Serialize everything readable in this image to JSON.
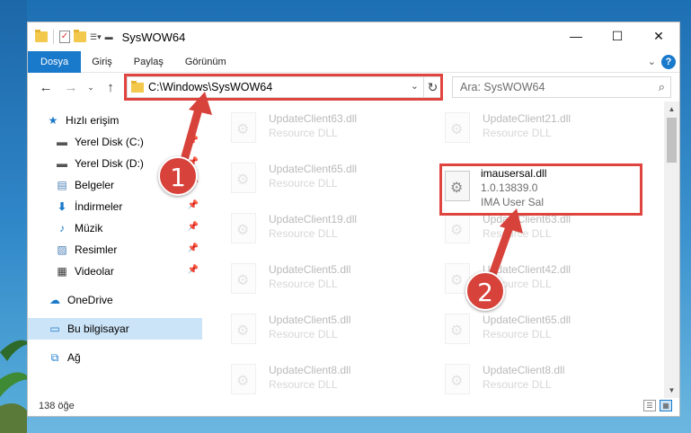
{
  "window": {
    "title": "SysWOW64",
    "controls": [
      "minimize-icon",
      "maximize-icon",
      "close-icon"
    ]
  },
  "ribbon": {
    "tabs": [
      "Dosya",
      "Giriş",
      "Paylaş",
      "Görünüm"
    ]
  },
  "address": {
    "path": "C:\\Windows\\SysWOW64",
    "search_placeholder": "Ara: SysWOW64"
  },
  "nav": {
    "items": [
      {
        "label": "Hızlı erişim",
        "icon": "star-icon"
      },
      {
        "label": "Yerel Disk (C:)",
        "icon": "drive-icon"
      },
      {
        "label": "Yerel Disk (D:)",
        "icon": "drive-icon"
      },
      {
        "label": "Belgeler",
        "icon": "documents-icon"
      },
      {
        "label": "İndirmeler",
        "icon": "download-icon"
      },
      {
        "label": "Müzik",
        "icon": "music-icon"
      },
      {
        "label": "Resimler",
        "icon": "pictures-icon"
      },
      {
        "label": "Videolar",
        "icon": "video-icon"
      },
      {
        "label": "OneDrive",
        "icon": "cloud-icon"
      },
      {
        "label": "Bu bilgisayar",
        "icon": "computer-icon"
      },
      {
        "label": "Ağ",
        "icon": "network-icon"
      }
    ]
  },
  "files": {
    "left": [
      {
        "name": "UpdateClient63.dll",
        "desc": "Resource DLL"
      },
      {
        "name": "UpdateClient65.dll",
        "desc": "Resource DLL"
      },
      {
        "name": "UpdateClient19.dll",
        "desc": "Resource DLL"
      },
      {
        "name": "UpdateClient5.dll",
        "desc": "Resource DLL"
      },
      {
        "name": "UpdateClient5.dll",
        "desc": "Resource DLL"
      },
      {
        "name": "UpdateClient8.dll",
        "desc": "Resource DLL"
      }
    ],
    "right": [
      {
        "name": "UpdateClient21.dll",
        "desc": "Resource DLL"
      },
      {
        "name": "UpdateClient63.dll",
        "desc": "Resource DLL"
      },
      {
        "name": "UpdateClient42.dll",
        "desc": "Resource DLL"
      },
      {
        "name": "UpdateClient65.dll",
        "desc": "Resource DLL"
      },
      {
        "name": "UpdateClient8.dll",
        "desc": "Resource DLL"
      }
    ],
    "highlighted": {
      "name": "imausersal.dll",
      "version": "1.0.13839.0",
      "desc": "IMA User Sal"
    }
  },
  "status": {
    "count": "138 öğe"
  },
  "callouts": [
    "1",
    "2"
  ],
  "colors": {
    "accent": "#1979ca",
    "highlight": "#e0443f",
    "badge": "#d7423b"
  }
}
